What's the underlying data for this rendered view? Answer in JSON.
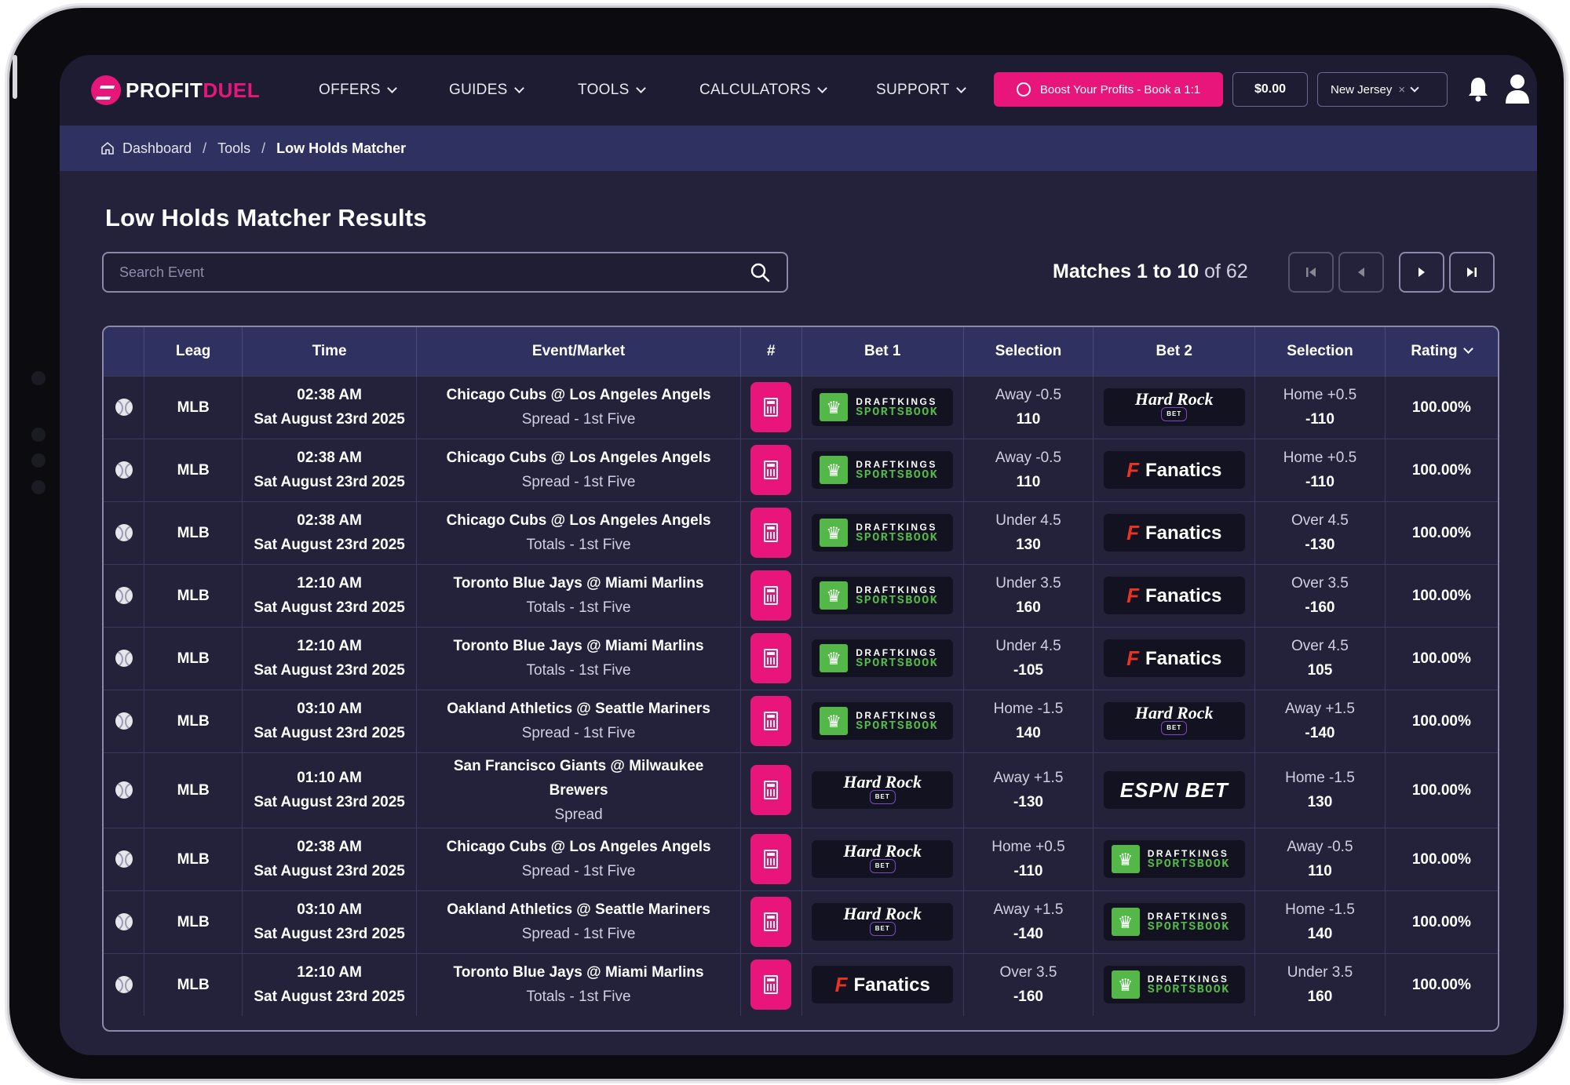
{
  "brand": {
    "part1": "PROFIT",
    "part2": "DUEL"
  },
  "nav": [
    {
      "label": "OFFERS"
    },
    {
      "label": "GUIDES"
    },
    {
      "label": "TOOLS"
    },
    {
      "label": "CALCULATORS"
    },
    {
      "label": "SUPPORT"
    }
  ],
  "header": {
    "boost_label": "Boost Your Profits - Book a 1:1",
    "balance": "$0.00",
    "state": "New Jersey",
    "state_clear": "×"
  },
  "breadcrumb": {
    "home": "Dashboard",
    "sep": "/",
    "tools": "Tools",
    "current": "Low Holds Matcher"
  },
  "page": {
    "title": "Low Holds Matcher Results"
  },
  "search": {
    "placeholder": "Search Event",
    "value": ""
  },
  "pagination": {
    "prefix": "Matches 1 to 10",
    "suffix": "of 62"
  },
  "table": {
    "headers": {
      "league": "Leag",
      "time": "Time",
      "event": "Event/Market",
      "num": "#",
      "bet1": "Bet 1",
      "sel1": "Selection",
      "bet2": "Bet 2",
      "sel2": "Selection",
      "rating": "Rating"
    },
    "rows": [
      {
        "league": "MLB",
        "time": "02:38 AM",
        "date": "Sat August 23rd 2025",
        "event": "Chicago Cubs @ Los Angeles Angels",
        "market": "Spread - 1st Five",
        "bet1": "draftkings",
        "sel1_label": "Away -0.5",
        "sel1_odds": "110",
        "bet2": "hardrock",
        "sel2_label": "Home +0.5",
        "sel2_odds": "-110",
        "rating": "100.00%"
      },
      {
        "league": "MLB",
        "time": "02:38 AM",
        "date": "Sat August 23rd 2025",
        "event": "Chicago Cubs @ Los Angeles Angels",
        "market": "Spread - 1st Five",
        "bet1": "draftkings",
        "sel1_label": "Away -0.5",
        "sel1_odds": "110",
        "bet2": "fanatics",
        "sel2_label": "Home +0.5",
        "sel2_odds": "-110",
        "rating": "100.00%"
      },
      {
        "league": "MLB",
        "time": "02:38 AM",
        "date": "Sat August 23rd 2025",
        "event": "Chicago Cubs @ Los Angeles Angels",
        "market": "Totals - 1st Five",
        "bet1": "draftkings",
        "sel1_label": "Under 4.5",
        "sel1_odds": "130",
        "bet2": "fanatics",
        "sel2_label": "Over 4.5",
        "sel2_odds": "-130",
        "rating": "100.00%"
      },
      {
        "league": "MLB",
        "time": "12:10 AM",
        "date": "Sat August 23rd 2025",
        "event": "Toronto Blue Jays @ Miami Marlins",
        "market": "Totals - 1st Five",
        "bet1": "draftkings",
        "sel1_label": "Under 3.5",
        "sel1_odds": "160",
        "bet2": "fanatics",
        "sel2_label": "Over 3.5",
        "sel2_odds": "-160",
        "rating": "100.00%"
      },
      {
        "league": "MLB",
        "time": "12:10 AM",
        "date": "Sat August 23rd 2025",
        "event": "Toronto Blue Jays @ Miami Marlins",
        "market": "Totals - 1st Five",
        "bet1": "draftkings",
        "sel1_label": "Under 4.5",
        "sel1_odds": "-105",
        "bet2": "fanatics",
        "sel2_label": "Over 4.5",
        "sel2_odds": "105",
        "rating": "100.00%"
      },
      {
        "league": "MLB",
        "time": "03:10 AM",
        "date": "Sat August 23rd 2025",
        "event": "Oakland Athletics @ Seattle Mariners",
        "market": "Spread - 1st Five",
        "bet1": "draftkings",
        "sel1_label": "Home -1.5",
        "sel1_odds": "140",
        "bet2": "hardrock",
        "sel2_label": "Away +1.5",
        "sel2_odds": "-140",
        "rating": "100.00%"
      },
      {
        "league": "MLB",
        "time": "01:10 AM",
        "date": "Sat August 23rd 2025",
        "event": "San Francisco Giants @ Milwaukee Brewers",
        "market": "Spread",
        "bet1": "hardrock",
        "sel1_label": "Away +1.5",
        "sel1_odds": "-130",
        "bet2": "espnbet",
        "sel2_label": "Home -1.5",
        "sel2_odds": "130",
        "rating": "100.00%"
      },
      {
        "league": "MLB",
        "time": "02:38 AM",
        "date": "Sat August 23rd 2025",
        "event": "Chicago Cubs @ Los Angeles Angels",
        "market": "Spread - 1st Five",
        "bet1": "hardrock",
        "sel1_label": "Home +0.5",
        "sel1_odds": "-110",
        "bet2": "draftkings",
        "sel2_label": "Away -0.5",
        "sel2_odds": "110",
        "rating": "100.00%"
      },
      {
        "league": "MLB",
        "time": "03:10 AM",
        "date": "Sat August 23rd 2025",
        "event": "Oakland Athletics @ Seattle Mariners",
        "market": "Spread - 1st Five",
        "bet1": "hardrock",
        "sel1_label": "Away +1.5",
        "sel1_odds": "-140",
        "bet2": "draftkings",
        "sel2_label": "Home -1.5",
        "sel2_odds": "140",
        "rating": "100.00%"
      },
      {
        "league": "MLB",
        "time": "12:10 AM",
        "date": "Sat August 23rd 2025",
        "event": "Toronto Blue Jays @ Miami Marlins",
        "market": "Totals - 1st Five",
        "bet1": "fanatics",
        "sel1_label": "Over 3.5",
        "sel1_odds": "-160",
        "bet2": "draftkings",
        "sel2_label": "Under 3.5",
        "sel2_odds": "160",
        "rating": "100.00%"
      }
    ]
  },
  "sportsbooks": {
    "draftkings": {
      "line1": "DRAFTKINGS",
      "line2": "SPORTSBOOK"
    },
    "hardrock": {
      "line1": "Hard Rock",
      "line2": "BET"
    },
    "fanatics": {
      "mark": "F",
      "line1": "Fanatics"
    },
    "espnbet": {
      "line1": "ESPN BET"
    }
  },
  "colors": {
    "accent": "#e8167a",
    "background": "#24223a",
    "header": "#1e1c33",
    "breadcrumb": "#2f3260",
    "draftkings_green": "#53b848",
    "fanatics_red": "#ea3323"
  }
}
